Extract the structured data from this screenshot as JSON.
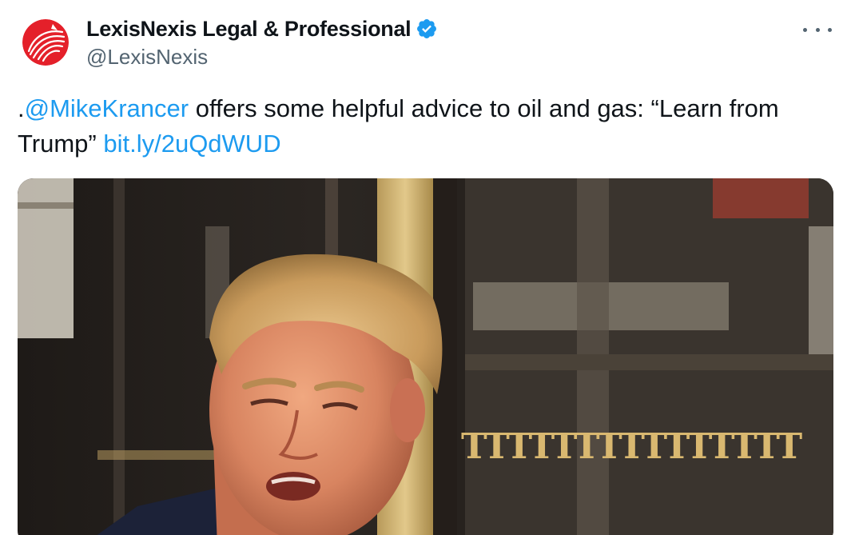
{
  "author": {
    "display_name": "LexisNexis Legal & Professional",
    "handle": "@LexisNexis",
    "verified": true,
    "avatar_icon": "lexisnexis-logo-icon",
    "brand_color": "#e4202a"
  },
  "tweet": {
    "prefix": ".",
    "mention": "@MikeKrancer",
    "body_1": " offers some helpful advice to oil and gas: “Learn from",
    "body_2": "Trump” ",
    "link": "bit.ly/2uQdWUD"
  },
  "media": {
    "sign_text": "TTTTTTTTTTTTTTT"
  },
  "colors": {
    "link": "#1d9bf0",
    "verified": "#1d9bf0",
    "secondary_text": "#536471"
  },
  "icons": {
    "verified": "verified-badge-icon",
    "more": "more-options-icon"
  }
}
